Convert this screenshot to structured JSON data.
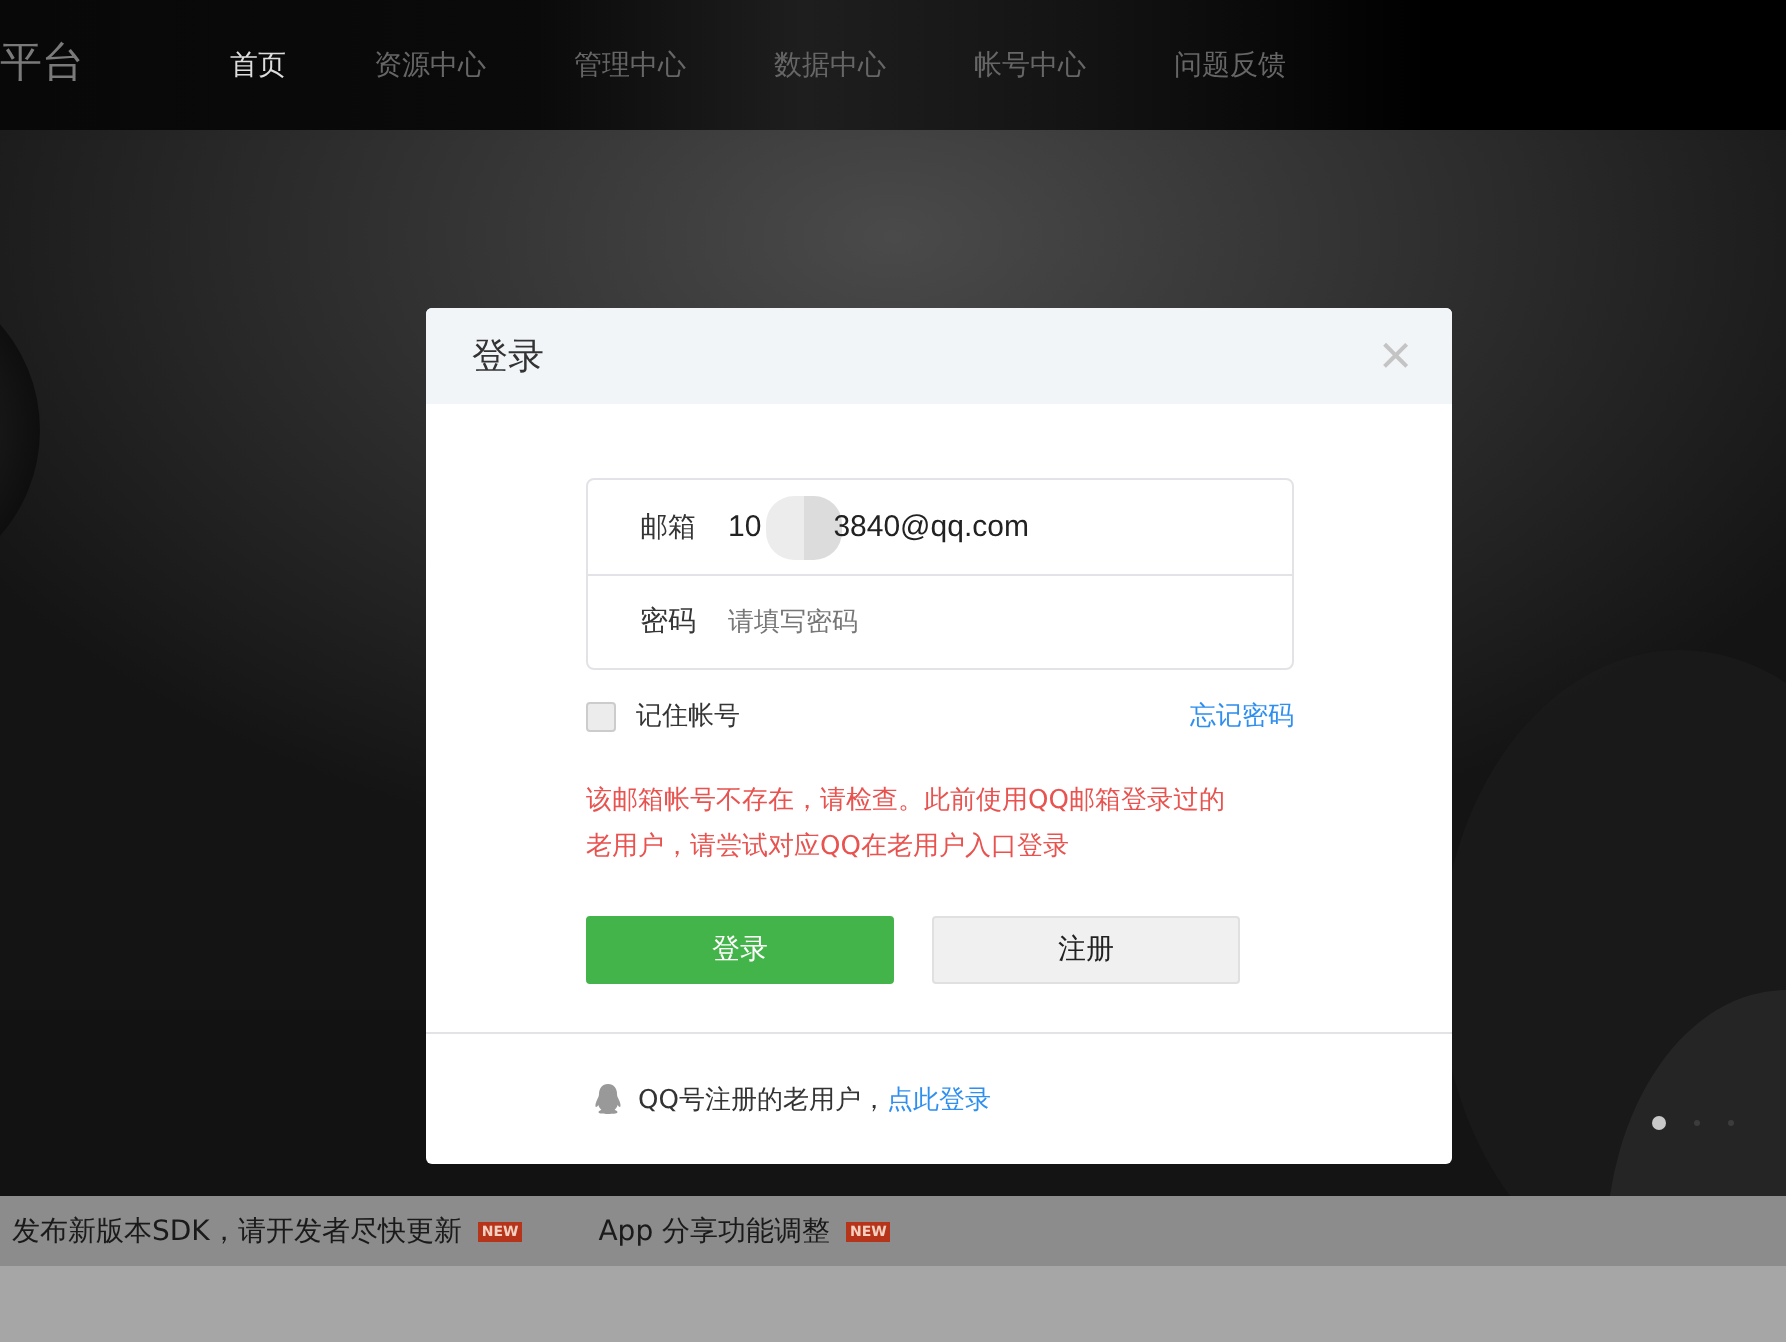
{
  "header": {
    "logo": "平台",
    "nav": [
      {
        "label": "首页",
        "selected": true
      },
      {
        "label": "资源中心",
        "selected": false
      },
      {
        "label": "管理中心",
        "selected": false
      },
      {
        "label": "数据中心",
        "selected": false
      },
      {
        "label": "帐号中心",
        "selected": false
      },
      {
        "label": "问题反馈",
        "selected": false
      }
    ]
  },
  "hero": {
    "carousel": [
      {
        "selected": true
      },
      {
        "selected": false
      },
      {
        "selected": false
      }
    ]
  },
  "dialog": {
    "title": "登录",
    "close": "×",
    "fields": [
      {
        "kind": "email",
        "label": "邮箱",
        "value_start": "10",
        "value_end": "3840@qq.com"
      },
      {
        "kind": "password",
        "label": "密码",
        "placeholder": "请填写密码"
      }
    ],
    "remember": {
      "label": "记住帐号",
      "checked": false
    },
    "forgot": "忘记密码",
    "error": "该邮箱帐号不存在，请检查。此前使用QQ邮箱登录过的老用户，请尝试对应QQ在老用户入口登录",
    "buttons": [
      {
        "kind": "primary",
        "label": "登录"
      },
      {
        "kind": "secondary",
        "label": "注册"
      }
    ],
    "footer": {
      "text": "QQ号注册的老用户，",
      "link": "点此登录"
    }
  },
  "ticker": [
    {
      "text": "发布新版本SDK，请开发者尽快更新",
      "badge": "NEW"
    },
    {
      "text": "App 分享功能调整",
      "badge": "NEW"
    }
  ]
}
